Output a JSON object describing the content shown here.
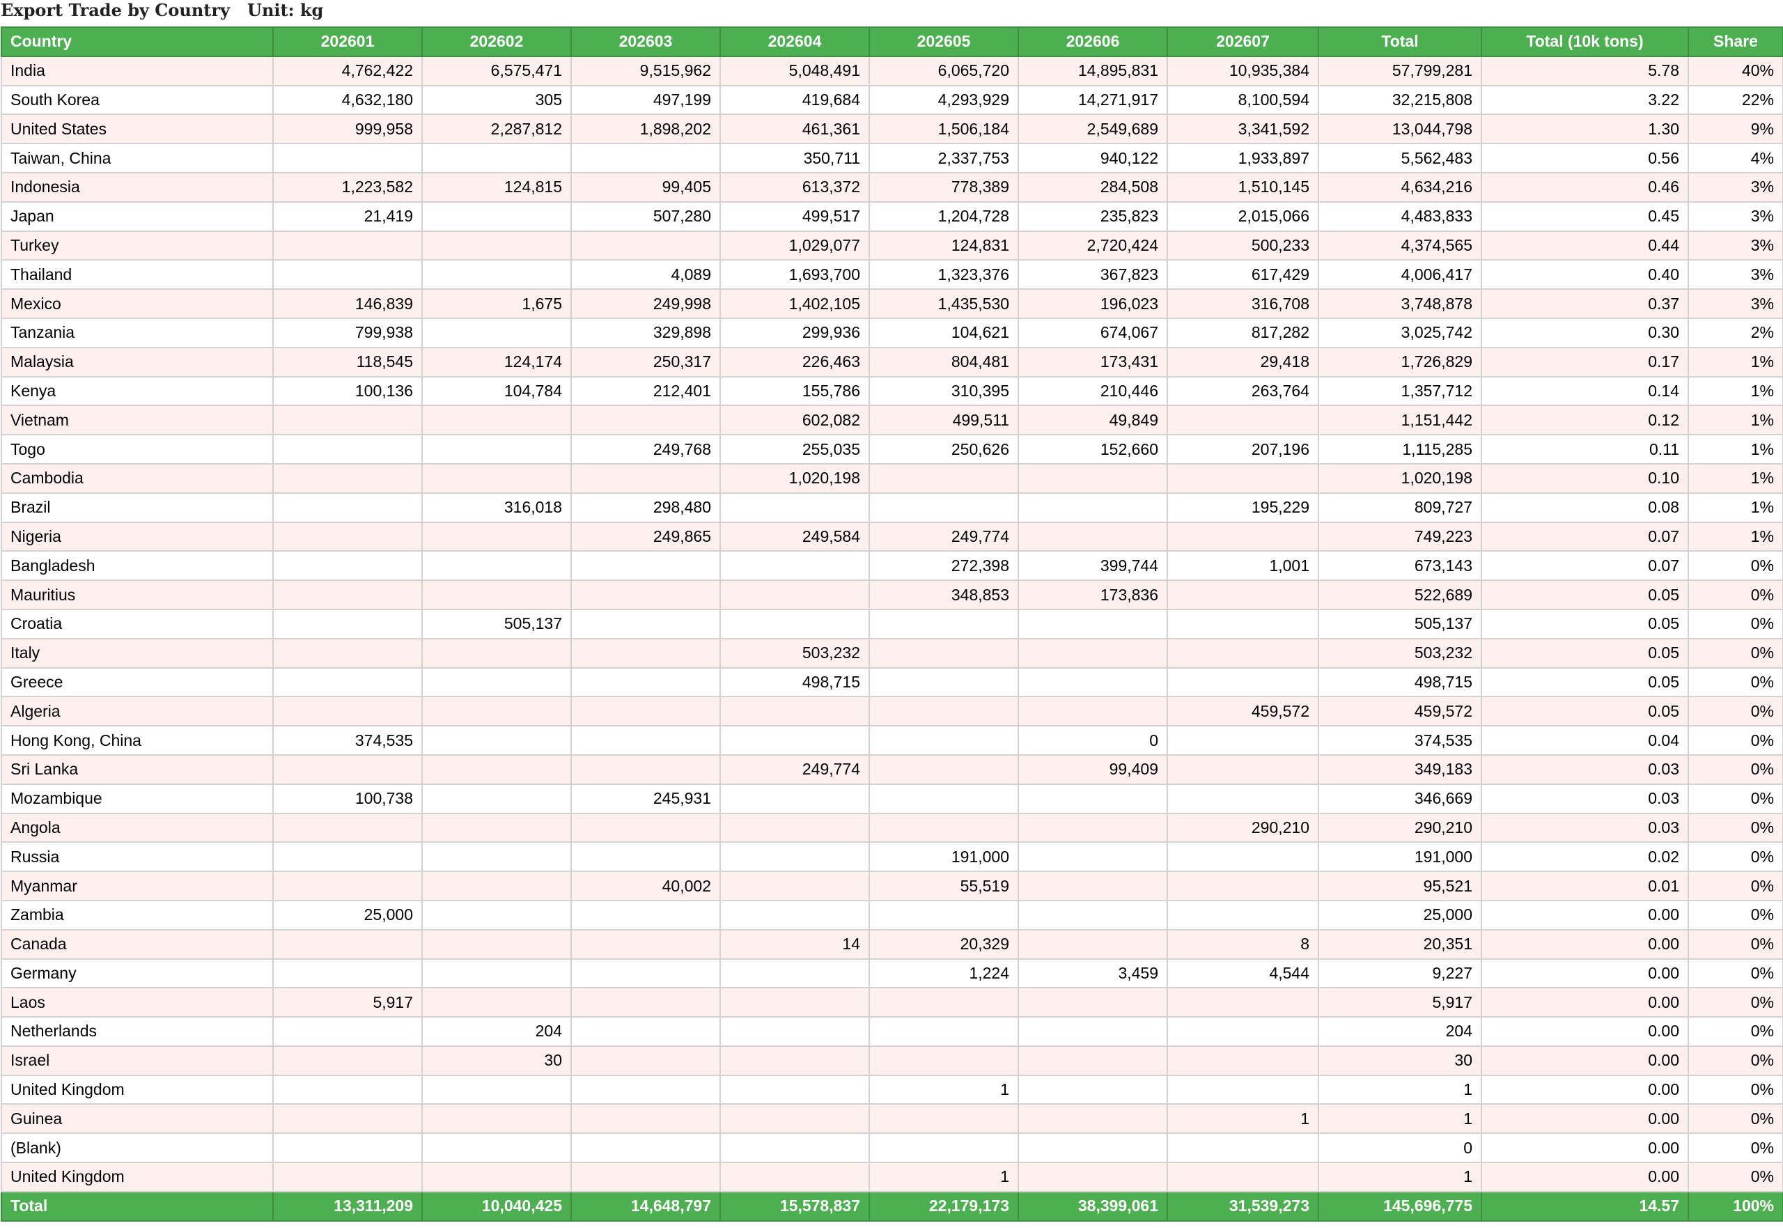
{
  "title": "Export Trade by Country   Unit: kg",
  "headers": [
    "Country",
    "202601",
    "202602",
    "202603",
    "202604",
    "202605",
    "202606",
    "202607",
    "Total",
    "Total (10k tons)",
    "Share"
  ],
  "rows": [
    [
      "India",
      "4,762,422",
      "6,575,471",
      "9,515,962",
      "5,048,491",
      "6,065,720",
      "14,895,831",
      "10,935,384",
      "57,799,281",
      "5.78",
      "40%"
    ],
    [
      "South Korea",
      "4,632,180",
      "305",
      "497,199",
      "419,684",
      "4,293,929",
      "14,271,917",
      "8,100,594",
      "32,215,808",
      "3.22",
      "22%"
    ],
    [
      "United States",
      "999,958",
      "2,287,812",
      "1,898,202",
      "461,361",
      "1,506,184",
      "2,549,689",
      "3,341,592",
      "13,044,798",
      "1.30",
      "9%"
    ],
    [
      "Taiwan, China",
      "",
      "",
      "",
      "350,711",
      "2,337,753",
      "940,122",
      "1,933,897",
      "5,562,483",
      "0.56",
      "4%"
    ],
    [
      "Indonesia",
      "1,223,582",
      "124,815",
      "99,405",
      "613,372",
      "778,389",
      "284,508",
      "1,510,145",
      "4,634,216",
      "0.46",
      "3%"
    ],
    [
      "Japan",
      "21,419",
      "",
      "507,280",
      "499,517",
      "1,204,728",
      "235,823",
      "2,015,066",
      "4,483,833",
      "0.45",
      "3%"
    ],
    [
      "Turkey",
      "",
      "",
      "",
      "1,029,077",
      "124,831",
      "2,720,424",
      "500,233",
      "4,374,565",
      "0.44",
      "3%"
    ],
    [
      "Thailand",
      "",
      "",
      "4,089",
      "1,693,700",
      "1,323,376",
      "367,823",
      "617,429",
      "4,006,417",
      "0.40",
      "3%"
    ],
    [
      "Mexico",
      "146,839",
      "1,675",
      "249,998",
      "1,402,105",
      "1,435,530",
      "196,023",
      "316,708",
      "3,748,878",
      "0.37",
      "3%"
    ],
    [
      "Tanzania",
      "799,938",
      "",
      "329,898",
      "299,936",
      "104,621",
      "674,067",
      "817,282",
      "3,025,742",
      "0.30",
      "2%"
    ],
    [
      "Malaysia",
      "118,545",
      "124,174",
      "250,317",
      "226,463",
      "804,481",
      "173,431",
      "29,418",
      "1,726,829",
      "0.17",
      "1%"
    ],
    [
      "Kenya",
      "100,136",
      "104,784",
      "212,401",
      "155,786",
      "310,395",
      "210,446",
      "263,764",
      "1,357,712",
      "0.14",
      "1%"
    ],
    [
      "Vietnam",
      "",
      "",
      "",
      "602,082",
      "499,511",
      "49,849",
      "",
      "1,151,442",
      "0.12",
      "1%"
    ],
    [
      "Togo",
      "",
      "",
      "249,768",
      "255,035",
      "250,626",
      "152,660",
      "207,196",
      "1,115,285",
      "0.11",
      "1%"
    ],
    [
      "Cambodia",
      "",
      "",
      "",
      "1,020,198",
      "",
      "",
      "",
      "1,020,198",
      "0.10",
      "1%"
    ],
    [
      "Brazil",
      "",
      "316,018",
      "298,480",
      "",
      "",
      "",
      "195,229",
      "809,727",
      "0.08",
      "1%"
    ],
    [
      "Nigeria",
      "",
      "",
      "249,865",
      "249,584",
      "249,774",
      "",
      "",
      "749,223",
      "0.07",
      "1%"
    ],
    [
      "Bangladesh",
      "",
      "",
      "",
      "",
      "272,398",
      "399,744",
      "1,001",
      "673,143",
      "0.07",
      "0%"
    ],
    [
      "Mauritius",
      "",
      "",
      "",
      "",
      "348,853",
      "173,836",
      "",
      "522,689",
      "0.05",
      "0%"
    ],
    [
      "Croatia",
      "",
      "505,137",
      "",
      "",
      "",
      "",
      "",
      "505,137",
      "0.05",
      "0%"
    ],
    [
      "Italy",
      "",
      "",
      "",
      "503,232",
      "",
      "",
      "",
      "503,232",
      "0.05",
      "0%"
    ],
    [
      "Greece",
      "",
      "",
      "",
      "498,715",
      "",
      "",
      "",
      "498,715",
      "0.05",
      "0%"
    ],
    [
      "Algeria",
      "",
      "",
      "",
      "",
      "",
      "",
      "459,572",
      "459,572",
      "0.05",
      "0%"
    ],
    [
      "Hong Kong, China",
      "374,535",
      "",
      "",
      "",
      "",
      "0",
      "",
      "374,535",
      "0.04",
      "0%"
    ],
    [
      "Sri Lanka",
      "",
      "",
      "",
      "249,774",
      "",
      "99,409",
      "",
      "349,183",
      "0.03",
      "0%"
    ],
    [
      "Mozambique",
      "100,738",
      "",
      "245,931",
      "",
      "",
      "",
      "",
      "346,669",
      "0.03",
      "0%"
    ],
    [
      "Angola",
      "",
      "",
      "",
      "",
      "",
      "",
      "290,210",
      "290,210",
      "0.03",
      "0%"
    ],
    [
      "Russia",
      "",
      "",
      "",
      "",
      "191,000",
      "",
      "",
      "191,000",
      "0.02",
      "0%"
    ],
    [
      "Myanmar",
      "",
      "",
      "40,002",
      "",
      "55,519",
      "",
      "",
      "95,521",
      "0.01",
      "0%"
    ],
    [
      "Zambia",
      "25,000",
      "",
      "",
      "",
      "",
      "",
      "",
      "25,000",
      "0.00",
      "0%"
    ],
    [
      "Canada",
      "",
      "",
      "",
      "14",
      "20,329",
      "",
      "8",
      "20,351",
      "0.00",
      "0%"
    ],
    [
      "Germany",
      "",
      "",
      "",
      "",
      "1,224",
      "3,459",
      "4,544",
      "9,227",
      "0.00",
      "0%"
    ],
    [
      "Laos",
      "5,917",
      "",
      "",
      "",
      "",
      "",
      "",
      "5,917",
      "0.00",
      "0%"
    ],
    [
      "Netherlands",
      "",
      "204",
      "",
      "",
      "",
      "",
      "",
      "204",
      "0.00",
      "0%"
    ],
    [
      "Israel",
      "",
      "30",
      "",
      "",
      "",
      "",
      "",
      "30",
      "0.00",
      "0%"
    ],
    [
      "United Kingdom",
      "",
      "",
      "",
      "",
      "1",
      "",
      "",
      "1",
      "0.00",
      "0%"
    ],
    [
      "Guinea",
      "",
      "",
      "",
      "",
      "",
      "",
      "1",
      "1",
      "0.00",
      "0%"
    ],
    [
      "(Blank)",
      "",
      "",
      "",
      "",
      "",
      "",
      "",
      "0",
      "0.00",
      "0%"
    ],
    [
      "United Kingdom",
      "",
      "",
      "",
      "",
      "1",
      "",
      "",
      "1",
      "0.00",
      "0%"
    ]
  ],
  "total_row": [
    "Total",
    "13,311,209",
    "10,040,425",
    "14,648,797",
    "15,578,837",
    "22,179,173",
    "38,399,061",
    "31,539,273",
    "145,696,775",
    "14.57",
    "100%"
  ],
  "colors": {
    "header_bg": "#4caf50",
    "odd_row_bg": "#fff0f0",
    "even_row_bg": "#ffffff",
    "border": "#d2d2d2"
  }
}
